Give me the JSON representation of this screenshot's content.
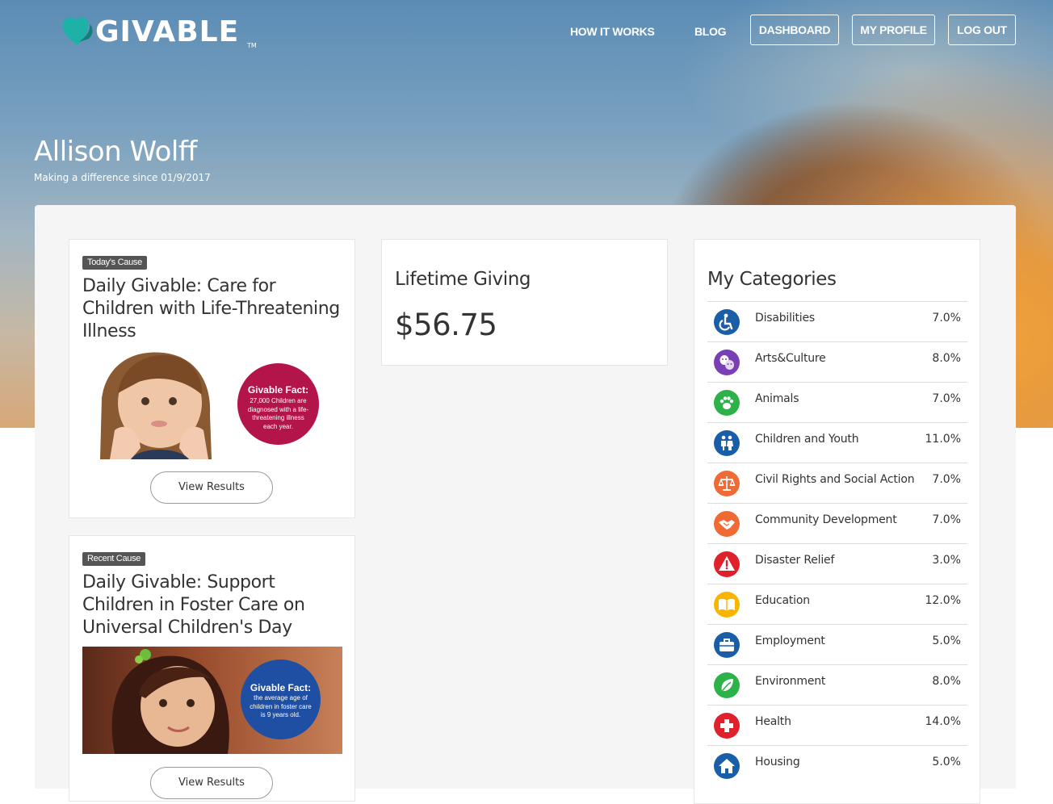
{
  "brand": {
    "name": "GIVABLE",
    "tm": "TM"
  },
  "nav": {
    "how_it_works": "HOW IT WORKS",
    "blog": "BLOG",
    "dashboard": "DASHBOARD",
    "my_profile": "MY PROFILE",
    "log_out": "LOG OUT"
  },
  "user": {
    "name": "Allison Wolff",
    "since": "Making a difference since 01/9/2017"
  },
  "todays_cause": {
    "badge": "Today's Cause",
    "title": "Daily Givable: Care for Children with Life-Threatening Illness",
    "fact_head": "Givable Fact:",
    "fact_body": "27,000 Children are diagnosed with a life-threatening illness each year.",
    "button": "View Results"
  },
  "recent_cause": {
    "badge": "Recent Cause",
    "title": "Daily Givable: Support Children in Foster Care on Universal Children's Day",
    "fact_head": "Givable Fact:",
    "fact_body": "the average age of children in foster care is 9 years old.",
    "button": "View Results"
  },
  "lifetime": {
    "title": "Lifetime Giving",
    "amount": "$56.75"
  },
  "categories": {
    "title": "My Categories",
    "items": [
      {
        "label": "Disabilities",
        "pct": "7.0%",
        "icon": "wheelchair-icon",
        "color": "#1a5ea8"
      },
      {
        "label": "Arts&Culture",
        "pct": "8.0%",
        "icon": "theater-masks-icon",
        "color": "#7b3fb5"
      },
      {
        "label": "Animals",
        "pct": "7.0%",
        "icon": "paw-icon",
        "color": "#2db24a"
      },
      {
        "label": "Children and Youth",
        "pct": "11.0%",
        "icon": "children-icon",
        "color": "#1a5ea8"
      },
      {
        "label": "Civil Rights and Social Action",
        "pct": "7.0%",
        "icon": "scales-icon",
        "color": "#f06a35"
      },
      {
        "label": "Community Development",
        "pct": "7.0%",
        "icon": "handshake-icon",
        "color": "#f06a35"
      },
      {
        "label": "Disaster Relief",
        "pct": "3.0%",
        "icon": "warning-icon",
        "color": "#e0202a"
      },
      {
        "label": "Education",
        "pct": "12.0%",
        "icon": "book-icon",
        "color": "#f7b500"
      },
      {
        "label": "Employment",
        "pct": "5.0%",
        "icon": "briefcase-icon",
        "color": "#1a5ea8"
      },
      {
        "label": "Environment",
        "pct": "8.0%",
        "icon": "leaf-icon",
        "color": "#2db24a"
      },
      {
        "label": "Health",
        "pct": "14.0%",
        "icon": "medical-cross-icon",
        "color": "#e0202a"
      },
      {
        "label": "Housing",
        "pct": "5.0%",
        "icon": "house-icon",
        "color": "#1a5ea8"
      }
    ]
  }
}
